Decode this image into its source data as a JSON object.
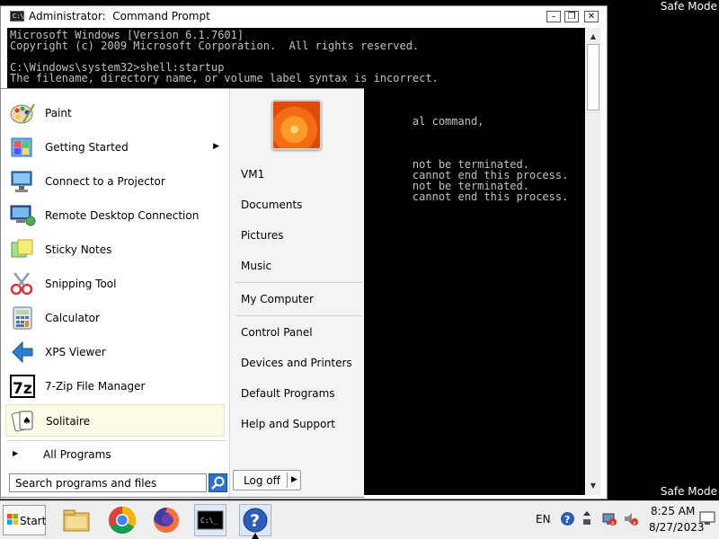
{
  "desktop": {
    "watermark_top": "Safe Mode",
    "watermark_bottom": "Safe Mode"
  },
  "cmd_window": {
    "title": "Administrator:  Command Prompt",
    "icon_text": "C:\\",
    "buttons": {
      "minimize": "–",
      "maximize": "❐",
      "close": "✕"
    },
    "console_lines": [
      "Microsoft Windows [Version 6.1.7601]",
      "Copyright (c) 2009 Microsoft Corporation.  All rights reserved.",
      "",
      "C:\\Windows\\system32>shell:startup",
      "The filename, directory name, or volume label syntax is incorrect.",
      "",
      "",
      "",
      "                                                              al command,",
      "",
      "",
      "",
      "                                                              not be terminated.",
      "                                                              cannot end this process.",
      "                                                              not be terminated.",
      "                                                              cannot end this process."
    ]
  },
  "start_menu": {
    "programs": [
      {
        "label": "Paint",
        "icon": "paint-icon"
      },
      {
        "label": "Getting Started",
        "icon": "getting-started-icon",
        "has_submenu": true
      },
      {
        "label": "Connect to a Projector",
        "icon": "projector-icon"
      },
      {
        "label": "Remote Desktop Connection",
        "icon": "remote-desktop-icon"
      },
      {
        "label": "Sticky Notes",
        "icon": "sticky-notes-icon"
      },
      {
        "label": "Snipping Tool",
        "icon": "scissors-icon"
      },
      {
        "label": "Calculator",
        "icon": "calculator-icon"
      },
      {
        "label": "XPS Viewer",
        "icon": "xps-viewer-icon"
      },
      {
        "label": "7-Zip File Manager",
        "icon": "7zip-icon"
      },
      {
        "label": "Solitaire",
        "icon": "solitaire-icon",
        "selected": true
      }
    ],
    "all_programs": "All Programs",
    "search_placeholder": "Search programs and files",
    "right_items": {
      "user": "VM1",
      "documents": "Documents",
      "pictures": "Pictures",
      "music": "Music",
      "my_computer": "My Computer",
      "control_panel": "Control Panel",
      "devices_printers": "Devices and Printers",
      "default_programs": "Default Programs",
      "help_support": "Help and Support"
    },
    "log_off": "Log off"
  },
  "taskbar": {
    "start_label": "Start",
    "pinned": [
      {
        "name": "file-explorer-icon"
      },
      {
        "name": "chrome-icon"
      },
      {
        "name": "firefox-icon"
      },
      {
        "name": "command-prompt-icon",
        "active": true
      },
      {
        "name": "help-icon",
        "active": true
      }
    ],
    "language": "EN",
    "clock_time": "8:25 AM",
    "clock_date": "8/27/2023"
  },
  "colors": {
    "console_bg": "#000000",
    "console_text": "#c0c0c0",
    "start_menu_right_bg": "#f4f4f4",
    "selected_item_bg": "#fdfbe6"
  }
}
